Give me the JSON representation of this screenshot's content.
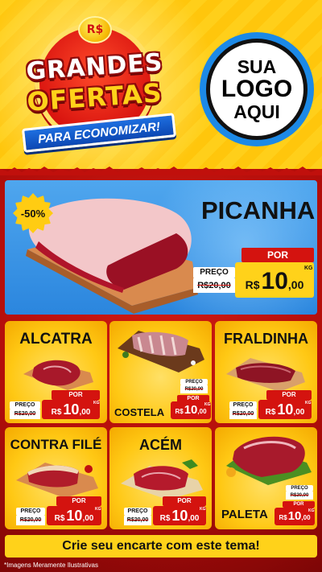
{
  "header": {
    "currency_badge": "R$",
    "title_line1": "GRANDES",
    "title_line2": "OFERTAS",
    "ribbon": "PARA ECONOMIZAR!",
    "logo": [
      "SUA",
      "LOGO",
      "AQUI"
    ]
  },
  "featured": {
    "discount": "-50%",
    "name": "PICANHA",
    "preco_label": "PREÇO",
    "old_price": "R$20,00",
    "por_label": "POR",
    "currency": "R$",
    "price_int": "10",
    "price_cents": ",00",
    "unit": "KG"
  },
  "products": [
    {
      "name": "ALCATRA",
      "preco_label": "PREÇO",
      "old_price": "R$20,00",
      "por_label": "POR",
      "currency": "R$",
      "price_int": "10",
      "price_cents": ",00",
      "unit": "KG"
    },
    {
      "name": "COSTELA",
      "preco_label": "PREÇO",
      "old_price": "R$20,00",
      "por_label": "POR",
      "currency": "R$",
      "price_int": "10",
      "price_cents": ",00",
      "unit": "KG"
    },
    {
      "name": "FRALDINHA",
      "preco_label": "PREÇO",
      "old_price": "R$20,00",
      "por_label": "POR",
      "currency": "R$",
      "price_int": "10",
      "price_cents": ",00",
      "unit": "KG"
    },
    {
      "name": "CONTRA FILÉ",
      "preco_label": "PREÇO",
      "old_price": "R$20,00",
      "por_label": "POR",
      "currency": "R$",
      "price_int": "10",
      "price_cents": ",00",
      "unit": "KG"
    },
    {
      "name": "ACÉM",
      "preco_label": "PREÇO",
      "old_price": "R$20,00",
      "por_label": "POR",
      "currency": "R$",
      "price_int": "10",
      "price_cents": ",00",
      "unit": "KG"
    },
    {
      "name": "PALETA",
      "preco_label": "PREÇO",
      "old_price": "R$20,00",
      "por_label": "POR",
      "currency": "R$",
      "price_int": "10",
      "price_cents": ",00",
      "unit": "KG"
    }
  ],
  "footer": {
    "cta": "Crie seu encarte com este tema!",
    "disclaimer": "*Imagens Meramente Ilustrativas"
  },
  "colors": {
    "yellow": "#ffd21a",
    "red": "#d4130f",
    "blue": "#2b86de",
    "dark_red": "#8c0a0a"
  }
}
